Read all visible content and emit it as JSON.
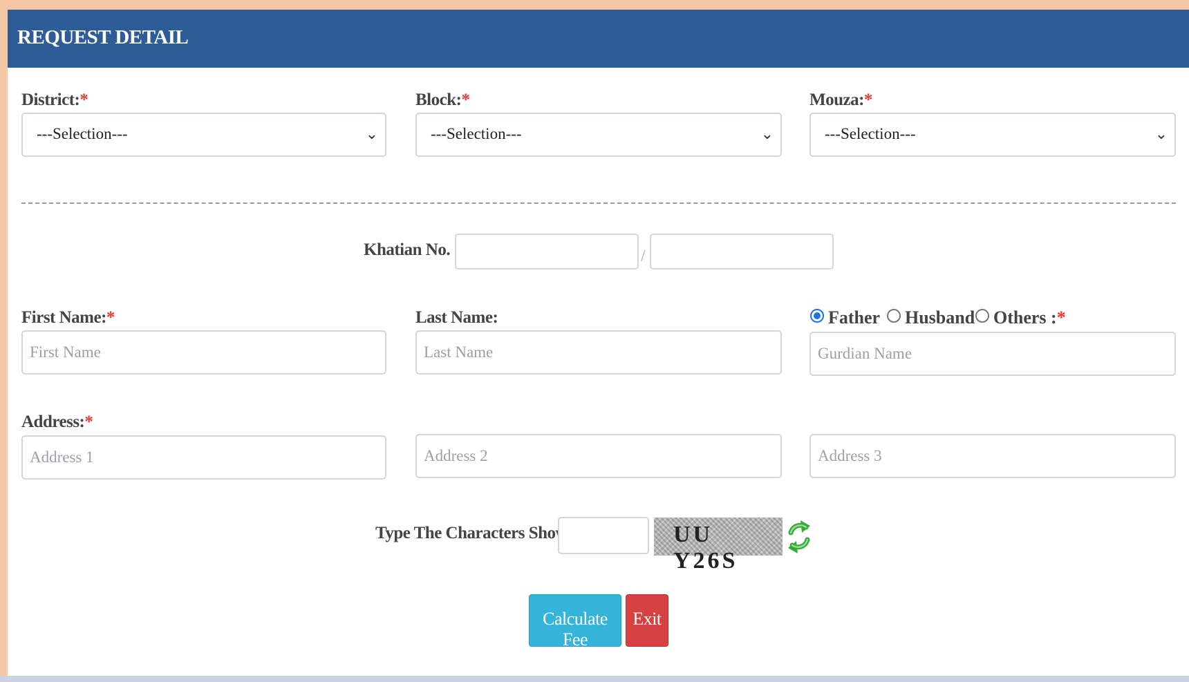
{
  "header": {
    "title": "REQUEST DETAIL"
  },
  "location": {
    "district": {
      "label": "District:",
      "required": "*",
      "value": "---Selection---"
    },
    "block": {
      "label": "Block:",
      "required": "*",
      "value": "---Selection---"
    },
    "mouza": {
      "label": "Mouza:",
      "required": "*",
      "value": "---Selection---"
    }
  },
  "khatian": {
    "label": "Khatian No. :",
    "required": "*",
    "separator": "/",
    "value1": "",
    "value2": ""
  },
  "name": {
    "first": {
      "label": "First Name:",
      "required": "*",
      "placeholder": "First Name"
    },
    "last": {
      "label": "Last Name:",
      "placeholder": "Last Name"
    },
    "guardian": {
      "options": [
        "Father",
        "Husband",
        "Others"
      ],
      "selected": "Father",
      "suffix": ":",
      "required": "*",
      "placeholder": "Gurdian Name"
    }
  },
  "address": {
    "label": "Address:",
    "required": "*",
    "placeholder1": "Address 1",
    "placeholder2": "Address 2",
    "placeholder3": "Address 3"
  },
  "captcha": {
    "label": "Type The Characters Shown:",
    "required": "*",
    "code": "UU Y26S",
    "refresh_icon": "refresh-icon"
  },
  "buttons": {
    "calculate": "Calculate Fee",
    "exit": "Exit"
  },
  "colors": {
    "header": "#2e5c97",
    "required": "#e53935",
    "calculate": "#35b3d8",
    "exit": "#d64242"
  }
}
